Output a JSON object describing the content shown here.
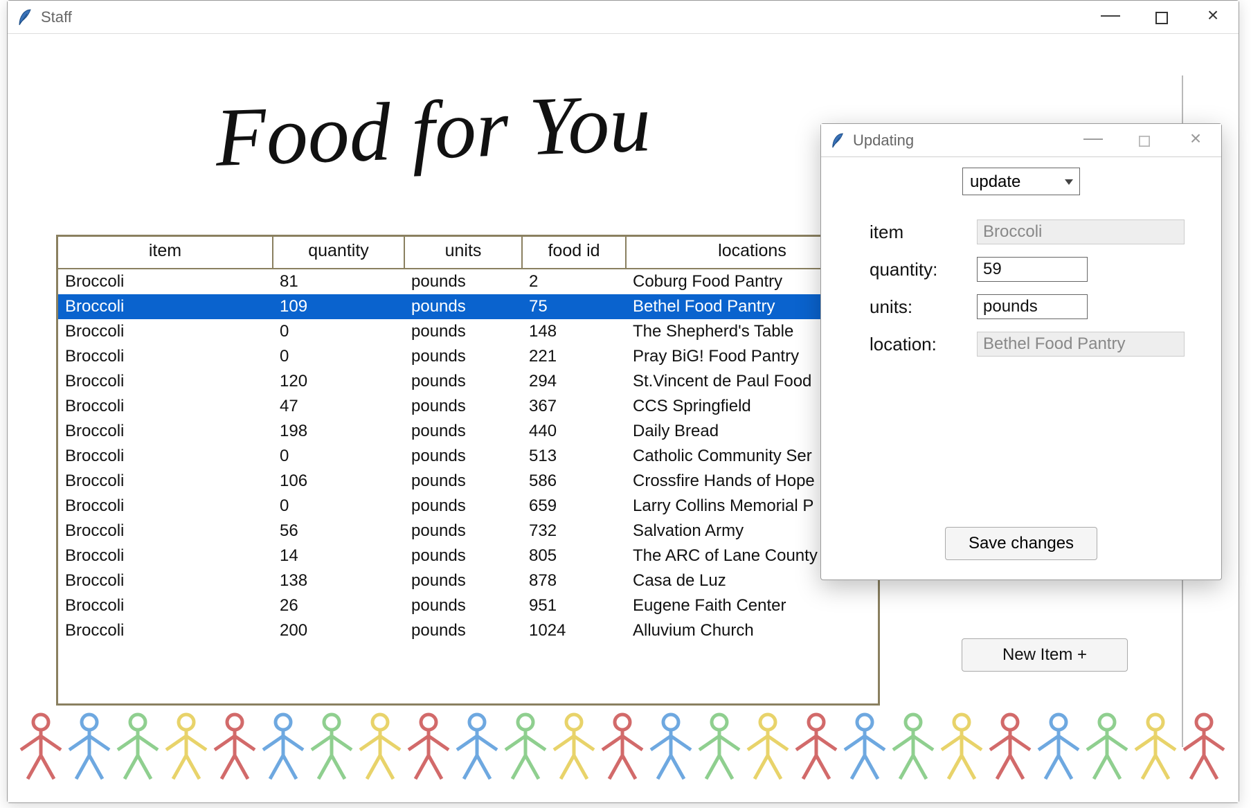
{
  "main_window": {
    "title": "Staff"
  },
  "logo_text": "Food for You",
  "table": {
    "headers": [
      "item",
      "quantity",
      "units",
      "food id",
      "locations"
    ],
    "selected_index": 1,
    "rows": [
      {
        "item": "Broccoli",
        "quantity": "81",
        "units": "pounds",
        "food_id": "2",
        "location": "Coburg Food Pantry"
      },
      {
        "item": "Broccoli",
        "quantity": "109",
        "units": "pounds",
        "food_id": "75",
        "location": "Bethel Food Pantry"
      },
      {
        "item": "Broccoli",
        "quantity": "0",
        "units": "pounds",
        "food_id": "148",
        "location": "The Shepherd's Table"
      },
      {
        "item": "Broccoli",
        "quantity": "0",
        "units": "pounds",
        "food_id": "221",
        "location": "Pray BiG! Food Pantry"
      },
      {
        "item": "Broccoli",
        "quantity": "120",
        "units": "pounds",
        "food_id": "294",
        "location": "St.Vincent de Paul Food"
      },
      {
        "item": "Broccoli",
        "quantity": "47",
        "units": "pounds",
        "food_id": "367",
        "location": "CCS Springfield"
      },
      {
        "item": "Broccoli",
        "quantity": "198",
        "units": "pounds",
        "food_id": "440",
        "location": "Daily Bread"
      },
      {
        "item": "Broccoli",
        "quantity": "0",
        "units": "pounds",
        "food_id": "513",
        "location": "Catholic Community Ser"
      },
      {
        "item": "Broccoli",
        "quantity": "106",
        "units": "pounds",
        "food_id": "586",
        "location": "Crossfire Hands of Hope"
      },
      {
        "item": "Broccoli",
        "quantity": "0",
        "units": "pounds",
        "food_id": "659",
        "location": "Larry Collins Memorial P"
      },
      {
        "item": "Broccoli",
        "quantity": "56",
        "units": "pounds",
        "food_id": "732",
        "location": "Salvation Army"
      },
      {
        "item": "Broccoli",
        "quantity": "14",
        "units": "pounds",
        "food_id": "805",
        "location": "The ARC of Lane County"
      },
      {
        "item": "Broccoli",
        "quantity": "138",
        "units": "pounds",
        "food_id": "878",
        "location": "Casa de Luz"
      },
      {
        "item": "Broccoli",
        "quantity": "26",
        "units": "pounds",
        "food_id": "951",
        "location": "Eugene Faith Center"
      },
      {
        "item": "Broccoli",
        "quantity": "200",
        "units": "pounds",
        "food_id": "1024",
        "location": "Alluvium Church"
      }
    ]
  },
  "new_item_button": "New Item +",
  "popup": {
    "title": "Updating",
    "action_select": "update",
    "labels": {
      "item": "item",
      "quantity": "quantity:",
      "units": "units:",
      "location": "location:"
    },
    "values": {
      "item": "Broccoli",
      "quantity": "59",
      "units": "pounds",
      "location": "Bethel Food Pantry"
    },
    "save_button": "Save changes"
  },
  "people_colors": [
    "#d26a6a",
    "#6ea8e0",
    "#8fcf8f",
    "#e8d36a",
    "#d26a6a",
    "#6ea8e0",
    "#8fcf8f",
    "#e8d36a",
    "#d26a6a",
    "#6ea8e0",
    "#8fcf8f",
    "#e8d36a",
    "#d26a6a",
    "#6ea8e0",
    "#8fcf8f",
    "#e8d36a",
    "#d26a6a",
    "#6ea8e0",
    "#8fcf8f",
    "#e8d36a",
    "#d26a6a",
    "#6ea8e0",
    "#8fcf8f",
    "#e8d36a",
    "#d26a6a",
    "#6ea8e0",
    "#8fcf8f"
  ]
}
